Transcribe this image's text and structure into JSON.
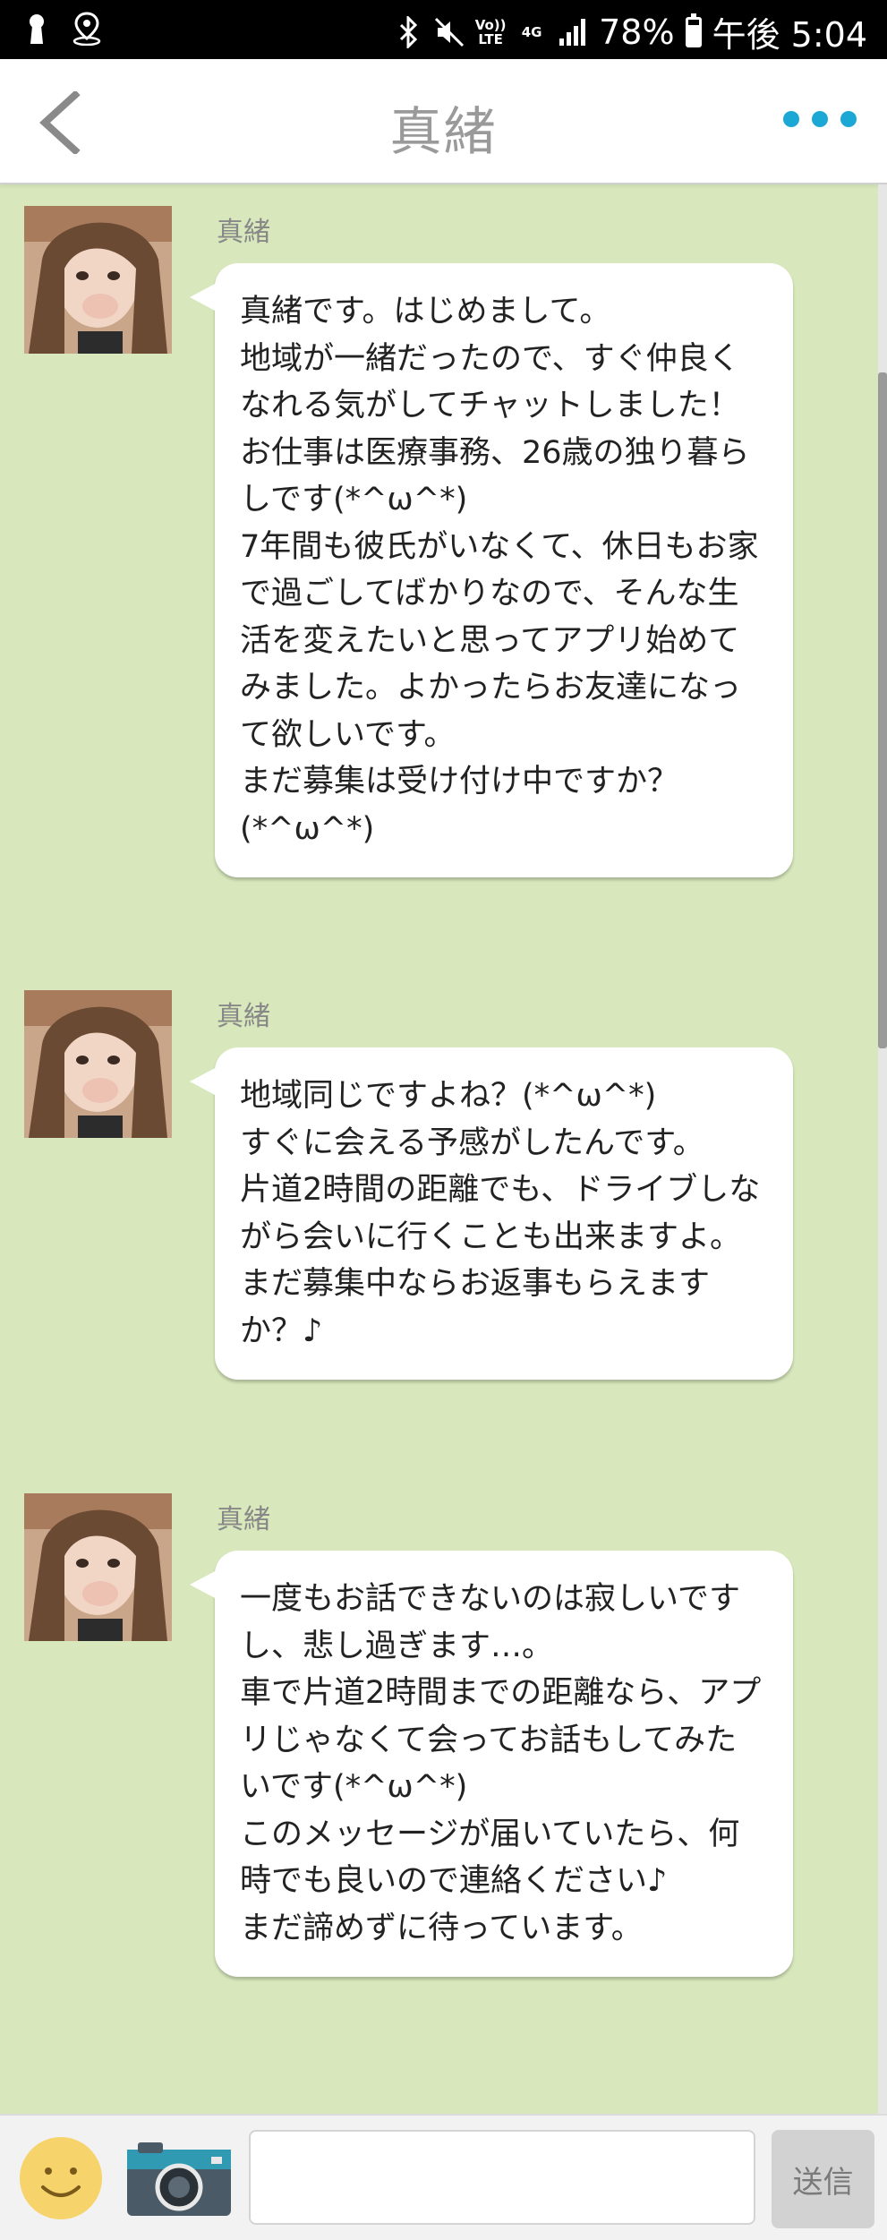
{
  "status_bar": {
    "battery": "78%",
    "time": "午後 5:04",
    "network_label": "4G",
    "volte_label": "Vo)) LTE",
    "battery_level": 0.78,
    "left_icons": [
      "keyhole-icon",
      "location-pin-icon"
    ],
    "right_icons": [
      "bluetooth-icon",
      "mute-icon",
      "volte-icon",
      "network-4g-icon",
      "signal-icon",
      "battery-icon"
    ]
  },
  "header": {
    "title": "真緒",
    "back_icon": "chevron-left-icon",
    "more_icon": "more-dots-icon",
    "accent_color": "#1ba8d4"
  },
  "messages": [
    {
      "sender": "真緒",
      "text": "真緒です。はじめまして。\n地域が一緒だったので、すぐ仲良くなれる気がしてチャットしました！お仕事は医療事務、26歳の独り暮らしです(*^ω^*)\n7年間も彼氏がいなくて、休日もお家で過ごしてばかりなので、そんな生活を変えたいと思ってアプリ始めてみました。よかったらお友達になって欲しいです。\nまだ募集は受け付け中ですか？(*^ω^*)"
    },
    {
      "sender": "真緒",
      "text": "地域同じですよね？(*^ω^*)\nすぐに会える予感がしたんです。\n片道2時間の距離でも、ドライブしながら会いに行くことも出来ますよ。\nまだ募集中ならお返事もらえますか？♪"
    },
    {
      "sender": "真緒",
      "text": "一度もお話できないのは寂しいですし、悲し過ぎます…。\n車で片道2時間までの距離なら、アプリじゃなくて会ってお話もしてみたいです(*^ω^*)\nこのメッセージが届いていたら、何時でも良いので連絡ください♪\nまだ諦めずに待っています。"
    }
  ],
  "input_bar": {
    "message_value": "",
    "send_label": "送信",
    "emoji_icon": "smiley-icon",
    "camera_icon": "camera-icon"
  },
  "colors": {
    "chat_background": "#d8e8bc",
    "bubble": "#ffffff",
    "accent": "#1ba8d4"
  }
}
